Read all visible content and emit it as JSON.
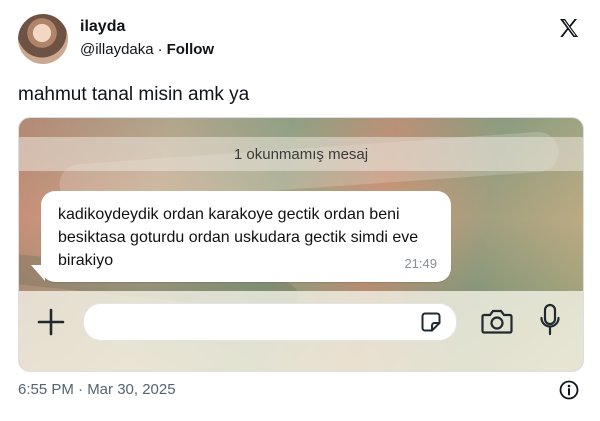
{
  "author": {
    "display_name": "ilayda",
    "handle": "@illaydaka",
    "separator": "·",
    "follow_label": "Follow"
  },
  "tweet": {
    "text": "mahmut tanal misin amk ya",
    "posted_time": "6:55 PM · Mar 30, 2025"
  },
  "screenshot": {
    "unread_banner": "1 okunmamış mesaj",
    "message": {
      "text": "kadikoydeydik ordan karakoye gectik ordan beni besiktasa goturdu ordan uskudara gectik simdi eve birakiyo",
      "time": "21:49"
    }
  },
  "icons": {
    "x_logo": "x-logo-icon",
    "plus": "plus-icon",
    "sticker": "sticker-icon",
    "camera": "camera-icon",
    "mic": "microphone-icon",
    "info": "info-icon"
  }
}
